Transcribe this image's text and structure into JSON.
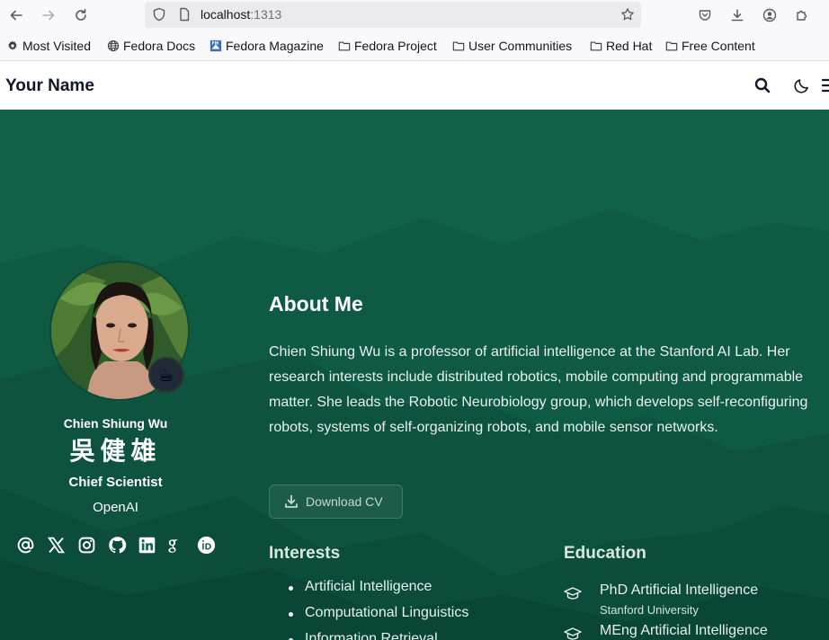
{
  "browser": {
    "url_host": "localhost",
    "url_port": ":1313",
    "bookmarks": [
      {
        "label": "Most Visited",
        "icon": "gear-icon"
      },
      {
        "label": "Fedora Docs",
        "icon": "globe-icon"
      },
      {
        "label": "Fedora Magazine",
        "icon": "fedora-magazine-icon"
      },
      {
        "label": "Fedora Project",
        "icon": "folder-icon"
      },
      {
        "label": "User Communities",
        "icon": "folder-icon"
      },
      {
        "label": "Red Hat",
        "icon": "folder-icon"
      },
      {
        "label": "Free Content",
        "icon": "folder-icon"
      }
    ]
  },
  "site": {
    "brand": "Your Name"
  },
  "profile": {
    "name": "Chien Shiung Wu",
    "name_cjk": "吳健雄",
    "role": "Chief Scientist",
    "org": "OpenAI",
    "badge_emoji": "☕",
    "social_icons": [
      "at-icon",
      "x-icon",
      "instagram-icon",
      "github-icon",
      "linkedin-icon",
      "google-scholar-icon",
      "orcid-icon"
    ]
  },
  "about": {
    "title": "About Me",
    "body": "Chien Shiung Wu is a professor of artificial intelligence at the Stanford AI Lab. Her research interests include distributed robotics, mobile computing and programmable matter. She leads the Robotic Neurobiology group, which develops self-reconfiguring robots, systems of self-organizing robots, and mobile sensor networks.",
    "cv_button": "Download CV"
  },
  "interests": {
    "title": "Interests",
    "items": [
      "Artificial Intelligence",
      "Computational Linguistics",
      "Information Retrieval"
    ]
  },
  "education": {
    "title": "Education",
    "items": [
      {
        "degree": "PhD Artificial Intelligence",
        "school": "Stanford University"
      },
      {
        "degree": "MEng Artificial Intelligence",
        "school": ""
      }
    ]
  },
  "colors": {
    "hero_bg": "#116148",
    "hero_dark": "#0b4d3a"
  }
}
